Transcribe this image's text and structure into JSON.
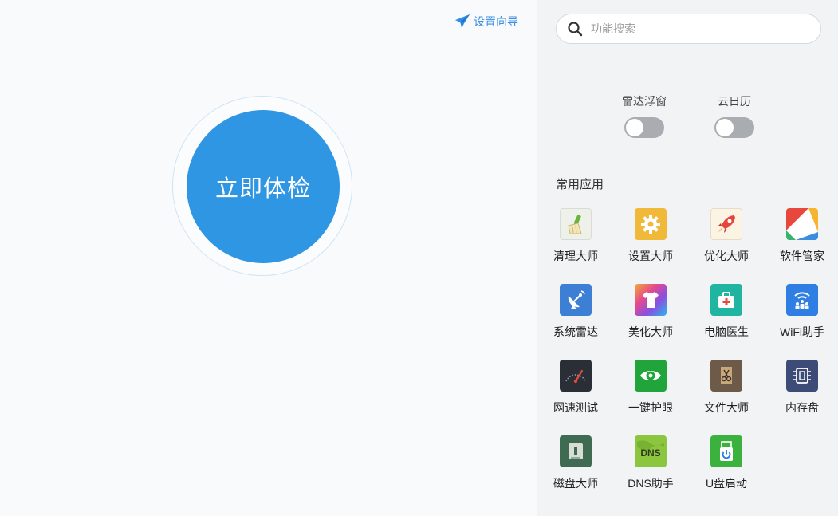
{
  "left": {
    "wizard_label": "设置向导",
    "check_button_label": "立即体检"
  },
  "right": {
    "search": {
      "placeholder": "功能搜索",
      "value": ""
    },
    "toggles": [
      {
        "label": "雷达浮窗",
        "on": false
      },
      {
        "label": "云日历",
        "on": false
      }
    ],
    "section_title": "常用应用",
    "apps": [
      {
        "label": "清理大师",
        "icon": "broom-icon"
      },
      {
        "label": "设置大师",
        "icon": "gear-icon"
      },
      {
        "label": "优化大师",
        "icon": "rocket-icon"
      },
      {
        "label": "软件管家",
        "icon": "software-manager-icon"
      },
      {
        "label": "系统雷达",
        "icon": "satellite-dish-icon"
      },
      {
        "label": "美化大师",
        "icon": "tshirt-icon"
      },
      {
        "label": "电脑医生",
        "icon": "first-aid-kit-icon"
      },
      {
        "label": "WiFi助手",
        "icon": "wifi-users-icon"
      },
      {
        "label": "网速测试",
        "icon": "speedometer-icon"
      },
      {
        "label": "一键护眼",
        "icon": "eye-icon"
      },
      {
        "label": "文件大师",
        "icon": "file-shredder-icon"
      },
      {
        "label": "内存盘",
        "icon": "memory-chip-icon"
      },
      {
        "label": "磁盘大师",
        "icon": "disk-icon"
      },
      {
        "label": "DNS助手",
        "icon": "dns-icon"
      },
      {
        "label": "U盘启动",
        "icon": "usb-boot-icon"
      }
    ]
  },
  "colors": {
    "accent": "#2f96e3",
    "wizard_text": "#3a8ee6",
    "toggle_off": "#a9acb0",
    "right_panel_bg": "#f2f3f5"
  }
}
